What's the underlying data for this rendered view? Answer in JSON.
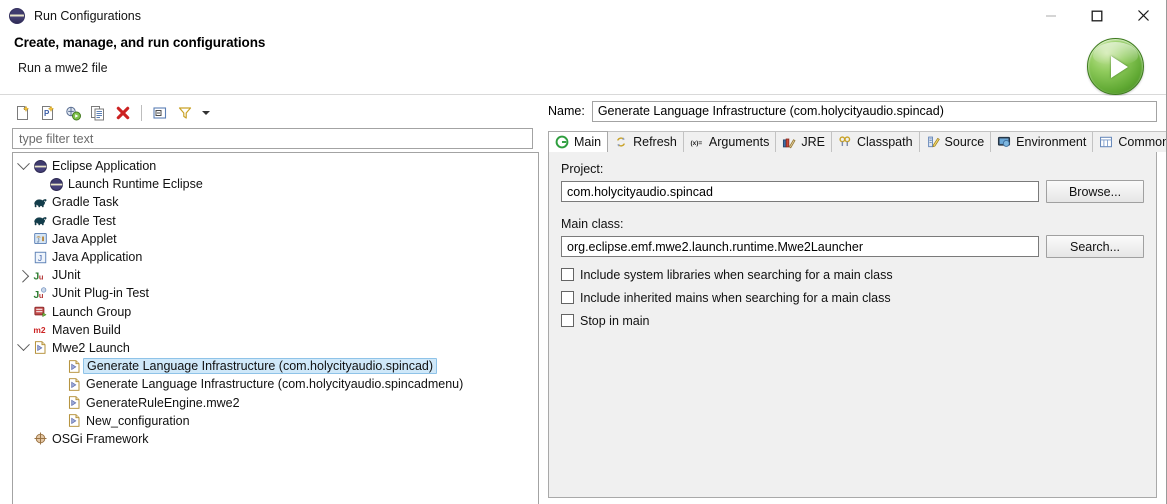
{
  "window": {
    "title": "Run Configurations",
    "icon": "eclipse-icon",
    "controls": {
      "minimize": "minimize-icon",
      "maximize": "maximize-icon",
      "close": "close-icon"
    }
  },
  "header": {
    "title": "Create, manage, and run configurations",
    "subtitle": "Run a mwe2 file",
    "run_button": "run-button"
  },
  "left_panel": {
    "toolbar": [
      {
        "name": "new-launch-configuration",
        "icon": "new-config-icon"
      },
      {
        "name": "new-prototype",
        "icon": "new-prototype-icon"
      },
      {
        "name": "export-configuration",
        "icon": "export-icon"
      },
      {
        "name": "duplicate-configuration",
        "icon": "duplicate-icon"
      },
      {
        "name": "delete-configuration",
        "icon": "delete-red-x-icon"
      },
      {
        "name": "collapse-all",
        "icon": "collapse-all-icon"
      },
      {
        "name": "filter-configurations",
        "icon": "filter-funnel-icon"
      },
      {
        "name": "view-menu",
        "icon": "chevron-down-icon"
      }
    ],
    "filter": {
      "placeholder": "type filter text",
      "value": ""
    },
    "tree": [
      {
        "label": "Eclipse Application",
        "icon": "eclipse-icon",
        "indent": 0,
        "twisty": "down",
        "selected": false
      },
      {
        "label": "Launch Runtime Eclipse",
        "icon": "eclipse-icon",
        "indent": 1,
        "twisty": "none",
        "selected": false
      },
      {
        "label": "Gradle Task",
        "icon": "gradle-elephant-icon",
        "indent": 0,
        "twisty": "none",
        "selected": false
      },
      {
        "label": "Gradle Test",
        "icon": "gradle-elephant-icon",
        "indent": 0,
        "twisty": "none",
        "selected": false
      },
      {
        "label": "Java Applet",
        "icon": "java-applet-icon",
        "indent": 0,
        "twisty": "none",
        "selected": false
      },
      {
        "label": "Java Application",
        "icon": "java-application-icon",
        "indent": 0,
        "twisty": "none",
        "selected": false
      },
      {
        "label": "JUnit",
        "icon": "junit-icon",
        "indent": 0,
        "twisty": "right",
        "selected": false
      },
      {
        "label": "JUnit Plug-in Test",
        "icon": "junit-plugin-icon",
        "indent": 0,
        "twisty": "none",
        "selected": false
      },
      {
        "label": "Launch Group",
        "icon": "launch-group-icon",
        "indent": 0,
        "twisty": "none",
        "selected": false
      },
      {
        "label": "Maven Build",
        "icon": "maven-m2-icon",
        "indent": 0,
        "twisty": "none",
        "selected": false
      },
      {
        "label": "Mwe2 Launch",
        "icon": "mwe2-icon",
        "indent": 0,
        "twisty": "down",
        "selected": false
      },
      {
        "label": "Generate Language Infrastructure (com.holycityaudio.spincad)",
        "icon": "mwe2-icon",
        "indent": 2,
        "twisty": "none",
        "selected": true
      },
      {
        "label": "Generate Language Infrastructure (com.holycityaudio.spincadmenu)",
        "icon": "mwe2-icon",
        "indent": 2,
        "twisty": "none",
        "selected": false
      },
      {
        "label": "GenerateRuleEngine.mwe2",
        "icon": "mwe2-icon",
        "indent": 2,
        "twisty": "none",
        "selected": false
      },
      {
        "label": "New_configuration",
        "icon": "mwe2-icon",
        "indent": 2,
        "twisty": "none",
        "selected": false
      },
      {
        "label": "OSGi Framework",
        "icon": "osgi-icon",
        "indent": 0,
        "twisty": "none",
        "selected": false
      }
    ]
  },
  "right_panel": {
    "name_label": "Name:",
    "name_value": "Generate Language Infrastructure (com.holycityaudio.spincad)",
    "tabs": [
      {
        "label": "Main",
        "icon": "main-green-circle-icon",
        "active": true
      },
      {
        "label": "Refresh",
        "icon": "refresh-arrows-icon",
        "active": false
      },
      {
        "label": "Arguments",
        "icon": "arguments-xequals-icon",
        "active": false
      },
      {
        "label": "JRE",
        "icon": "jre-books-icon",
        "active": false
      },
      {
        "label": "Classpath",
        "icon": "classpath-links-icon",
        "active": false
      },
      {
        "label": "Source",
        "icon": "source-pencil-icon",
        "active": false
      },
      {
        "label": "Environment",
        "icon": "environment-monitor-icon",
        "active": false
      },
      {
        "label": "Common",
        "icon": "common-table-icon",
        "active": false
      }
    ],
    "main_tab": {
      "project_label": "Project:",
      "project_value": "com.holycityaudio.spincad",
      "browse_label": "Browse...",
      "main_class_label": "Main class:",
      "main_class_value": "org.eclipse.emf.mwe2.launch.runtime.Mwe2Launcher",
      "search_label": "Search...",
      "checkboxes": [
        {
          "label": "Include system libraries when searching for a main class",
          "checked": false
        },
        {
          "label": "Include inherited mains when searching for a main class",
          "checked": false
        },
        {
          "label": "Stop in main",
          "checked": false
        }
      ]
    }
  },
  "colors": {
    "selection": "#cfe8f9",
    "selection_border": "#8fc3e8",
    "run_green": "#6fb83c",
    "panel_bg": "#f0f0f0",
    "border": "#a9a9a9",
    "delete_red": "#cc2222"
  }
}
